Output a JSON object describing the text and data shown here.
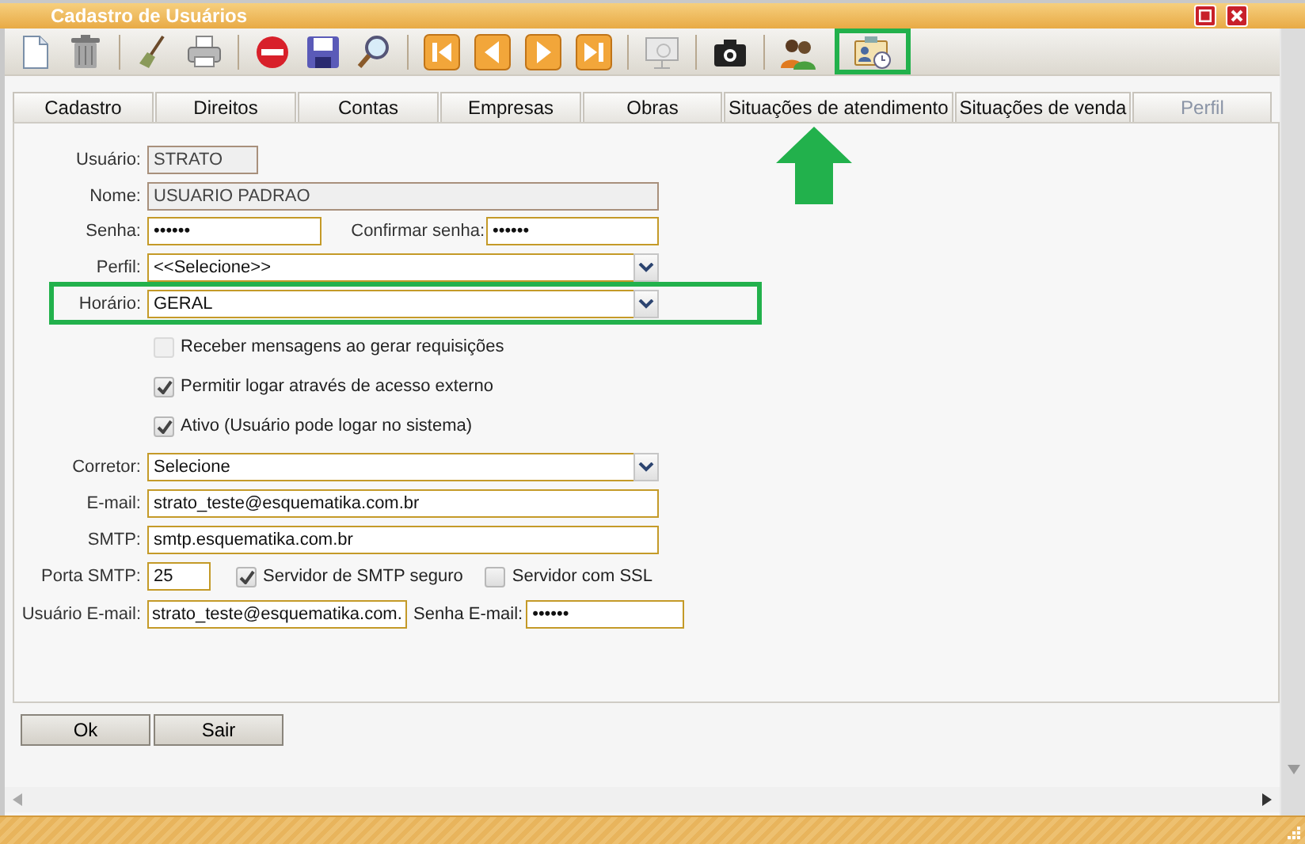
{
  "window": {
    "title": "Cadastro de Usuários"
  },
  "tabs": [
    {
      "label": "Cadastro",
      "disabled": false
    },
    {
      "label": "Direitos",
      "disabled": false
    },
    {
      "label": "Contas",
      "disabled": false
    },
    {
      "label": "Empresas",
      "disabled": false
    },
    {
      "label": "Obras",
      "disabled": false
    },
    {
      "label": "Situações de atendimento",
      "disabled": false
    },
    {
      "label": "Situações de venda",
      "disabled": false
    },
    {
      "label": "Perfil",
      "disabled": true
    }
  ],
  "form": {
    "usuario": {
      "label": "Usuário:",
      "value": "STRATO",
      "disabled": true
    },
    "nome": {
      "label": "Nome:",
      "value": "USUARIO PADRAO",
      "disabled": true
    },
    "senha": {
      "label": "Senha:",
      "value": "••••••",
      "disabled": false
    },
    "confirmar_senha": {
      "label": "Confirmar senha:",
      "value": "••••••",
      "disabled": false
    },
    "perfil": {
      "label": "Perfil:",
      "value": "<<Selecione>>"
    },
    "horario": {
      "label": "Horário:",
      "value": "GERAL"
    },
    "options": [
      {
        "label": "Receber mensagens ao gerar requisições",
        "checked": false,
        "disabled": true
      },
      {
        "label": "Permitir logar através de acesso externo",
        "checked": true,
        "disabled": false
      },
      {
        "label": "Ativo (Usuário pode logar no sistema)",
        "checked": true,
        "disabled": false
      }
    ],
    "corretor": {
      "label": "Corretor:",
      "value": "Selecione"
    },
    "email": {
      "label": "E-mail:",
      "value": "strato_teste@esquematika.com.br",
      "disabled": false
    },
    "smtp": {
      "label": "SMTP:",
      "value": "smtp.esquematika.com.br",
      "disabled": false
    },
    "porta_smtp": {
      "label": "Porta SMTP:",
      "value": "25",
      "disabled": false
    },
    "smtp_seguro": {
      "label": "Servidor de SMTP seguro",
      "checked": true
    },
    "servidor_ssl": {
      "label": "Servidor com SSL",
      "checked": false
    },
    "usuario_email": {
      "label": "Usuário E-mail:",
      "value": "strato_teste@esquematika.com.",
      "disabled": false
    },
    "senha_email": {
      "label": "Senha E-mail:",
      "value": "••••••",
      "disabled": false
    }
  },
  "buttons": [
    "Ok",
    "Sair"
  ]
}
